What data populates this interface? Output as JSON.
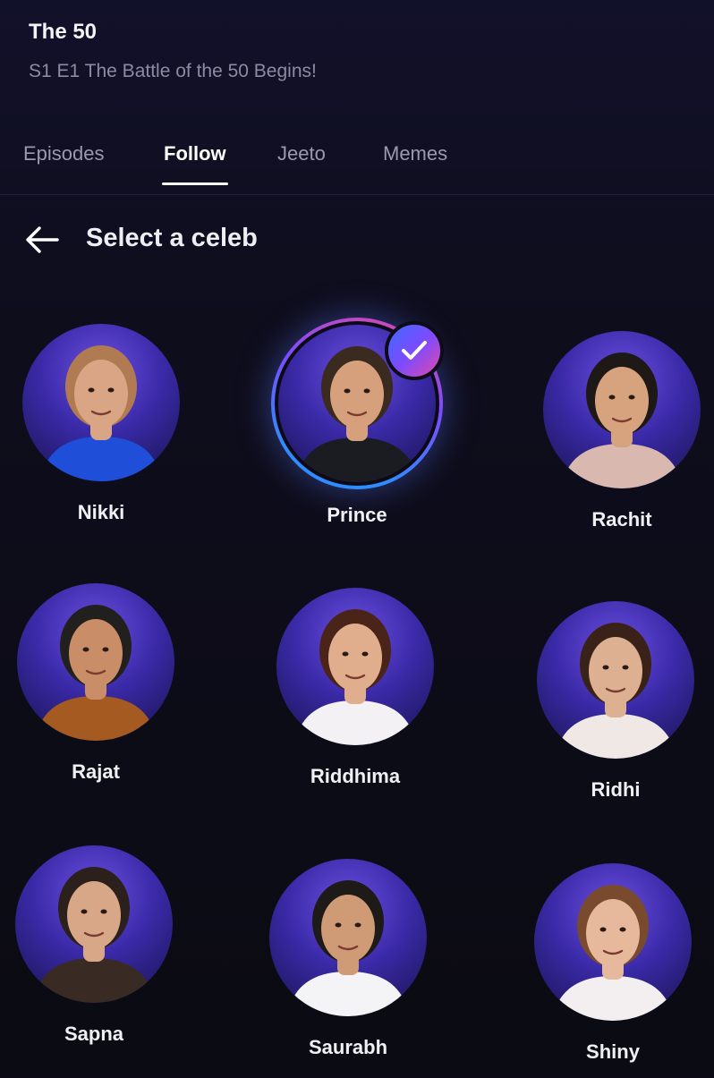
{
  "header": {
    "show_title": "The 50",
    "episode_title": "S1 E1 The Battle of the 50 Begins!"
  },
  "tabs": [
    {
      "label": "Episodes",
      "active": false
    },
    {
      "label": "Follow",
      "active": true
    },
    {
      "label": "Jeeto",
      "active": false
    },
    {
      "label": "Memes",
      "active": false
    }
  ],
  "select_section": {
    "back_icon": "arrow-left-icon",
    "title": "Select a celeb",
    "check_icon": "checkmark-icon"
  },
  "celebs": [
    {
      "name": "Nikki",
      "selected": false,
      "skin": "#d9a584",
      "hair": "#b07a52",
      "outfit": "#1f4fd8"
    },
    {
      "name": "Prince",
      "selected": true,
      "skin": "#d6a07c",
      "hair": "#3a2a20",
      "outfit": "#1b1b22"
    },
    {
      "name": "Rachit",
      "selected": false,
      "skin": "#d7a37e",
      "hair": "#1e1816",
      "outfit": "#d9b8b0"
    },
    {
      "name": "Rajat",
      "selected": false,
      "skin": "#c98d67",
      "hair": "#22201e",
      "outfit": "#a55a22"
    },
    {
      "name": "Riddhima",
      "selected": false,
      "skin": "#e0ae8c",
      "hair": "#4a2418",
      "outfit": "#f4f1f4"
    },
    {
      "name": "Ridhi",
      "selected": false,
      "skin": "#deb092",
      "hair": "#3b2218",
      "outfit": "#efe8e4"
    },
    {
      "name": "Sapna",
      "selected": false,
      "skin": "#d8a788",
      "hair": "#2b201c",
      "outfit": "#3a2a24"
    },
    {
      "name": "Saurabh",
      "selected": false,
      "skin": "#cf9a76",
      "hair": "#1d1a18",
      "outfit": "#f4f4f6"
    },
    {
      "name": "Shiny",
      "selected": false,
      "skin": "#e6b89c",
      "hair": "#7a4a2e",
      "outfit": "#f3eef0"
    }
  ],
  "colors": {
    "background": "#0c0b15",
    "accent_blue": "#2f8cff",
    "accent_pink": "#e24aa6",
    "accent_purple": "#7b4bff"
  }
}
